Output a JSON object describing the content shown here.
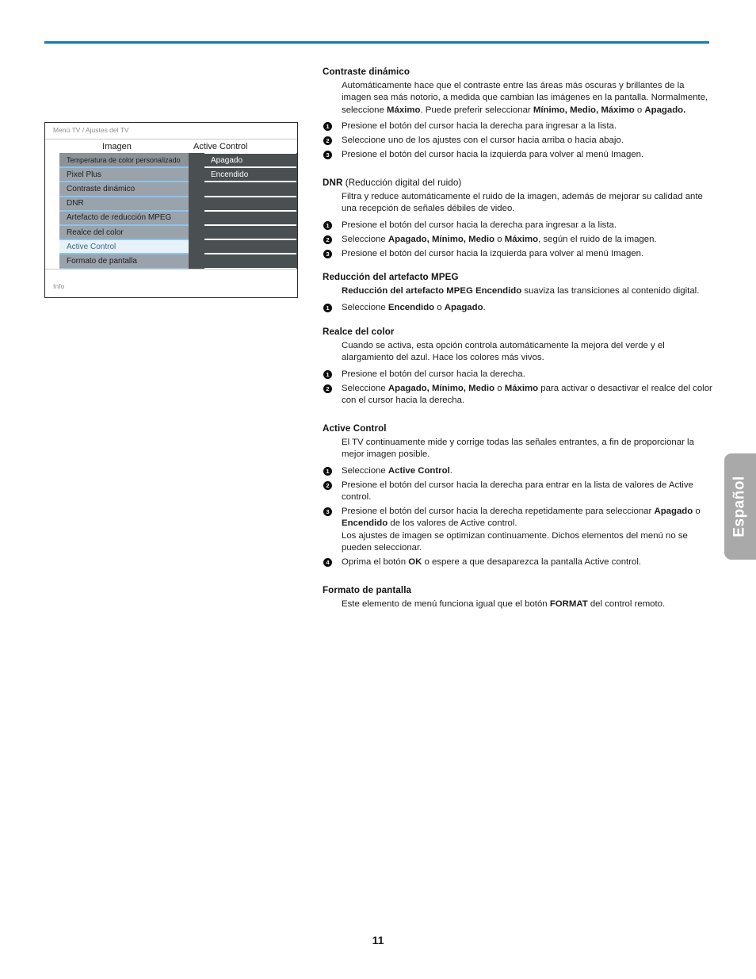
{
  "page": {
    "number": "11",
    "language_tab": "Español",
    "accent_color": "#1878bd"
  },
  "tv_menu": {
    "breadcrumb": "Menú TV / Ajustes del TV",
    "column_headers": {
      "left": "Imagen",
      "right": "Active Control"
    },
    "left_items": [
      {
        "label": "Temperatura de color personalizado",
        "state": "first"
      },
      {
        "label": "Pixel Plus",
        "state": "normal"
      },
      {
        "label": "Contraste dinámico",
        "state": "normal"
      },
      {
        "label": "DNR",
        "state": "normal"
      },
      {
        "label": "Artefacto de reducción MPEG",
        "state": "normal"
      },
      {
        "label": "Realce del color",
        "state": "normal"
      },
      {
        "label": "Active Control",
        "state": "selected"
      },
      {
        "label": "Formato de pantalla",
        "state": "normal"
      }
    ],
    "right_items": [
      {
        "label": "Apagado"
      },
      {
        "label": "Encendido"
      },
      {
        "label": ""
      },
      {
        "label": ""
      },
      {
        "label": ""
      },
      {
        "label": ""
      },
      {
        "label": ""
      },
      {
        "label": ""
      }
    ],
    "footer": "Info"
  },
  "sections": {
    "contraste": {
      "heading": "Contraste dinámico",
      "body": "Automáticamente hace que el contraste entre las áreas más oscuras y brillantes de la imagen sea más notorio, a medida que cambian las imágenes en la pantalla. Normalmente, seleccione ",
      "body_b1": "Máximo",
      "body_mid": ". Puede preferir seleccionar ",
      "body_b2": "Mínimo, Medio, Máximo",
      "body_mid2": " o ",
      "body_b3": "Apagado.",
      "steps": [
        {
          "num": "1",
          "text": "Presione el botón del cursor hacia la derecha para ingresar a la lista."
        },
        {
          "num": "2",
          "text": "Seleccione uno de los ajustes con el cursor hacia arriba o hacia abajo."
        },
        {
          "num": "3",
          "text": "Presione el botón del cursor hacia la izquierda para volver al menú Imagen."
        }
      ]
    },
    "dnr": {
      "heading_b": "DNR",
      "heading_reg": " (Reducción digital del ruido)",
      "body": "Filtra y reduce automáticamente el ruido de la imagen, además de mejorar su calidad ante una recepción de señales débiles de video.",
      "steps": [
        {
          "num": "1",
          "text": "Presione el botón del cursor hacia la derecha para ingresar a la lista."
        },
        {
          "num": "2",
          "pre": "Seleccione ",
          "bold": "Apagado, Mínimo, Medio",
          "mid": " o ",
          "bold2": "Máximo",
          "post": ", según el ruido de la imagen."
        },
        {
          "num": "3",
          "text": "Presione el botón del cursor hacia la izquierda para volver al menú Imagen."
        }
      ]
    },
    "mpeg": {
      "heading": "Reducción del artefacto MPEG",
      "sub_bold": "Reducción del artefacto MPEG Encendido",
      "sub_rest": " suaviza las transiciones al contenido digital.",
      "steps": [
        {
          "num": "1",
          "pre": "Seleccione ",
          "bold": "Encendido",
          "mid": " o ",
          "bold2": "Apagado",
          "post": "."
        }
      ]
    },
    "realce": {
      "heading": "Realce del color",
      "body": "Cuando se activa, esta opción controla automáticamente la mejora del verde y el alargamiento del azul. Hace los colores más vivos.",
      "steps": [
        {
          "num": "1",
          "text": "Presione el botón del cursor hacia la derecha."
        },
        {
          "num": "2",
          "pre": "Seleccione ",
          "bold": "Apagado, Mínimo, Medio",
          "mid": " o ",
          "bold2": "Máximo",
          "post": " para activar o desactivar el realce del color con el cursor hacia la derecha."
        }
      ]
    },
    "active_control": {
      "heading": "Active Control",
      "body": "El TV continuamente mide y corrige todas las señales entrantes, a fin de proporcionar la mejor imagen posible.",
      "steps": [
        {
          "num": "1",
          "pre": "Seleccione ",
          "bold": "Active Control",
          "post": "."
        },
        {
          "num": "2",
          "text": "Presione el botón del cursor hacia la derecha para entrar en la lista de valores de Active control."
        },
        {
          "num": "3",
          "pre": "Presione el botón del cursor hacia la derecha repetidamente para seleccionar ",
          "bold": "Apagado",
          "mid": " o ",
          "bold2": "Encendido",
          "post": " de los valores de Active control.",
          "extra": "Los ajustes de imagen se optimizan continuamente. Dichos elementos del menú no se pueden seleccionar."
        },
        {
          "num": "4",
          "pre": "Oprima el botón ",
          "bold": "OK",
          "post": " o espere a que desaparezca la pantalla Active control."
        }
      ]
    },
    "formato": {
      "heading": "Formato de pantalla",
      "body_pre": "Este elemento de menú funciona igual que el botón ",
      "body_bold": "FORMAT",
      "body_post": " del control remoto."
    }
  }
}
